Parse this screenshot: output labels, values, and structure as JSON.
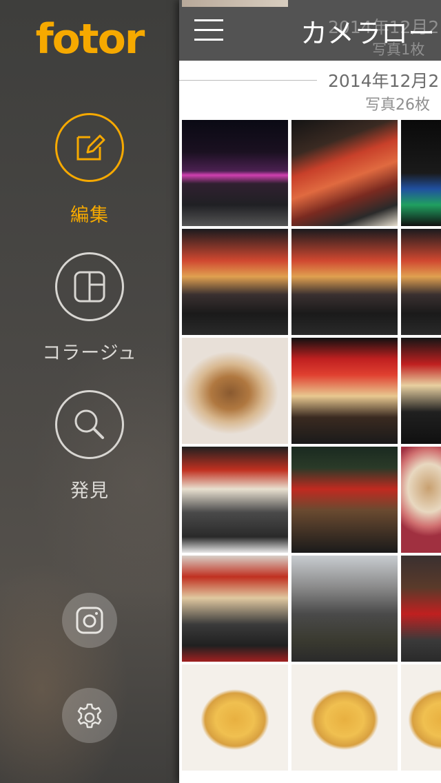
{
  "sidebar": {
    "logo": "fotor",
    "items": [
      {
        "label": "編集",
        "icon": "edit-icon",
        "active": true
      },
      {
        "label": "コラージュ",
        "icon": "collage-icon",
        "active": false
      },
      {
        "label": "発見",
        "icon": "search-icon",
        "active": false
      }
    ],
    "bottom": [
      {
        "icon": "instagram-icon"
      },
      {
        "icon": "gear-icon"
      }
    ]
  },
  "colors": {
    "accent": "#f6a900",
    "sidebar_text": "#dcdad6"
  },
  "topbar": {
    "title": "カメラロー",
    "ghost_date": "2014年12月2",
    "ghost_count": "写真1枚"
  },
  "section": {
    "date": "2014年12月2",
    "count": "写真26枚"
  },
  "photos": [
    {
      "icon": "night-street-photo"
    },
    {
      "icon": "crab-sign-photo"
    },
    {
      "icon": "night-sign-photo"
    },
    {
      "icon": "dotonbori-crowd-photo"
    },
    {
      "icon": "dotonbori-crowd-photo"
    },
    {
      "icon": "dotonbori-crowd-photo"
    },
    {
      "icon": "takoyaki-photo"
    },
    {
      "icon": "lantern-shop-photo"
    },
    {
      "icon": "lantern-shop-photo"
    },
    {
      "icon": "food-stall-photo"
    },
    {
      "icon": "night-alley-photo"
    },
    {
      "icon": "food-hand-photo"
    },
    {
      "icon": "shop-counter-photo"
    },
    {
      "icon": "shopping-street-photo"
    },
    {
      "icon": "shop-front-photo"
    },
    {
      "icon": "pancake-photo"
    },
    {
      "icon": "pancake-photo"
    },
    {
      "icon": "pancake-photo"
    }
  ]
}
